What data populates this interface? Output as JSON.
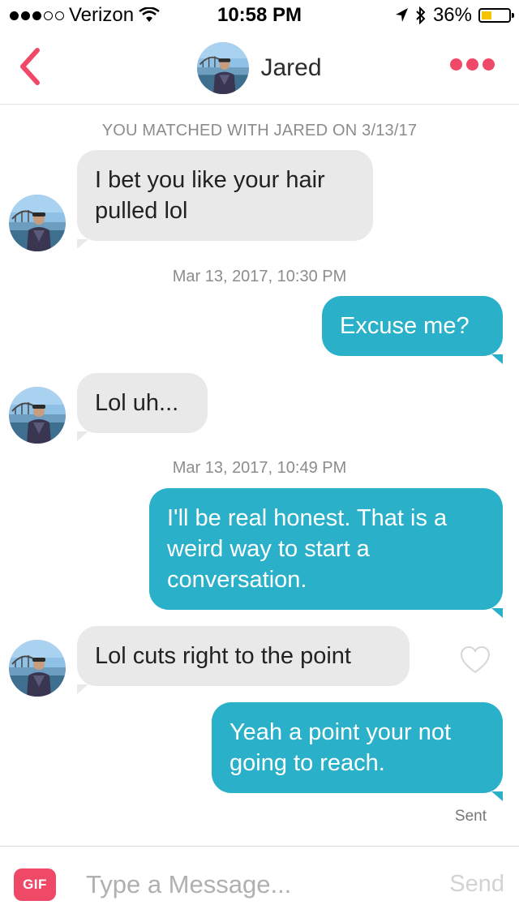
{
  "status_bar": {
    "carrier": "Verizon",
    "time": "10:58 PM",
    "battery": "36%",
    "battery_level": 0.36,
    "signal_bars": 3,
    "icons": [
      "wifi-icon",
      "location-arrow-icon",
      "bluetooth-icon",
      "battery-icon"
    ]
  },
  "header": {
    "name": "Jared",
    "back_icon": "chevron-left-icon",
    "more_icon": "more-dots-icon",
    "accent": "#ef4967"
  },
  "conversation": {
    "match_text": "YOU MATCHED WITH JARED ON 3/13/17",
    "messages": [
      {
        "from": "them",
        "text": "I bet you like your hair pulled lol"
      },
      {
        "type": "timestamp",
        "text": "Mar 13, 2017, 10:30 PM"
      },
      {
        "from": "me",
        "text": "Excuse me?"
      },
      {
        "from": "them",
        "text": "Lol uh..."
      },
      {
        "type": "timestamp",
        "text": "Mar 13, 2017, 10:49 PM"
      },
      {
        "from": "me",
        "text": "I'll be real honest. That is a weird way to start a conversation."
      },
      {
        "from": "them",
        "text": "Lol cuts right to the point"
      },
      {
        "from": "me",
        "text": "Yeah a point your not going to reach."
      }
    ],
    "sent_label": "Sent",
    "like_icon": "heart-outline-icon",
    "incoming_color": "#e9e9e9",
    "outgoing_color": "#2ab0c8"
  },
  "composer": {
    "gif_label": "GIF",
    "placeholder": "Type a Message...",
    "value": "",
    "send_label": "Send"
  }
}
